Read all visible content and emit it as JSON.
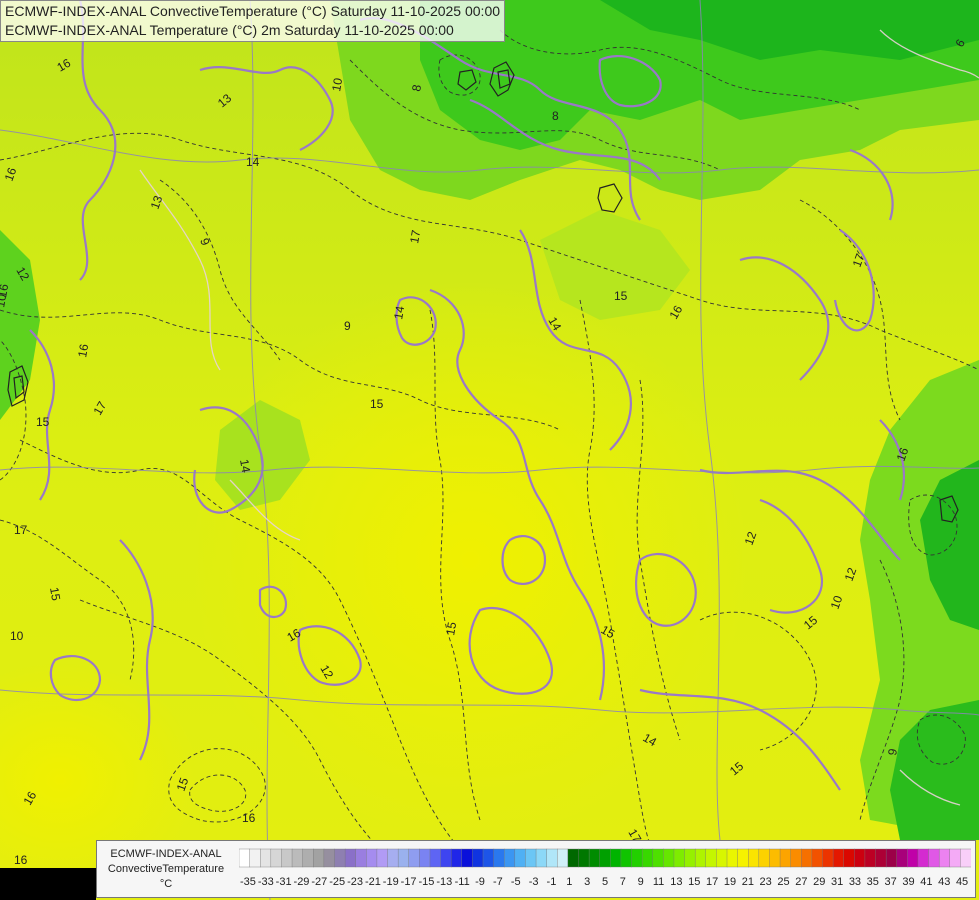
{
  "titles": {
    "line1": "ECMWF-INDEX-ANAL ConvectiveTemperature (°C) Saturday 11-10-2025 00:00",
    "line2": "ECMWF-INDEX-ANAL Temperature (°C) 2m Saturday 11-10-2025 00:00"
  },
  "legend": {
    "line1": "ECMWF-INDEX-ANAL",
    "line2": "ConvectiveTemperature",
    "unit": "°C",
    "tick_labels": [
      "-35",
      "-33",
      "-31",
      "-29",
      "-27",
      "-25",
      "-23",
      "-21",
      "-19",
      "-17",
      "-15",
      "-13",
      "-11",
      "-9",
      "-7",
      "-5",
      "-3",
      "-1",
      "1",
      "3",
      "5",
      "7",
      "9",
      "11",
      "13",
      "15",
      "17",
      "19",
      "21",
      "23",
      "25",
      "27",
      "29",
      "31",
      "33",
      "35",
      "37",
      "39",
      "41",
      "43",
      "45"
    ],
    "colors": [
      "#ffffff",
      "#f2f2f2",
      "#e4e4e4",
      "#d6d6d6",
      "#c8c8c8",
      "#bbbbbb",
      "#aeaeae",
      "#a2a2a2",
      "#968f9f",
      "#8e7fb1",
      "#8a70c8",
      "#9a7ee0",
      "#a58cef",
      "#b19bf5",
      "#a6aef0",
      "#9ab1ee",
      "#8f9df0",
      "#7a83f2",
      "#5e65f4",
      "#3e45f0",
      "#2026e8",
      "#0a10da",
      "#1034e0",
      "#1d55e8",
      "#2a78ee",
      "#3b96f2",
      "#4fb0f4",
      "#6bc6f5",
      "#8cd8f7",
      "#b0e6f8",
      "#d0f0f8",
      "#006800",
      "#007800",
      "#008c00",
      "#00a000",
      "#00b400",
      "#10c400",
      "#22d000",
      "#38d800",
      "#4ee000",
      "#66e600",
      "#7eec00",
      "#96f000",
      "#aef400",
      "#c4f600",
      "#d8f600",
      "#eaf600",
      "#f6f200",
      "#fae400",
      "#fcd200",
      "#fcbc00",
      "#fca400",
      "#fa8c00",
      "#f67000",
      "#f25200",
      "#ec3400",
      "#e41800",
      "#da0800",
      "#cc0010",
      "#bc0024",
      "#ac0036",
      "#9c0048",
      "#a8007a",
      "#c000a8",
      "#d42ad0",
      "#e058e6",
      "#ec82f0",
      "#f4aaf6",
      "#f9cff9"
    ]
  },
  "contour_labels": [
    "16",
    "16",
    "15",
    "14",
    "13",
    "10",
    "8",
    "8",
    "15",
    "16",
    "17",
    "16",
    "15",
    "14",
    "9",
    "14",
    "16",
    "15",
    "16",
    "15",
    "17",
    "16",
    "15",
    "17",
    "16",
    "16",
    "15",
    "17",
    "14",
    "15",
    "9",
    "10",
    "10",
    "13",
    "12",
    "12",
    "9",
    "12",
    "10",
    "16",
    "17",
    "12",
    "14",
    "15",
    "6"
  ]
}
